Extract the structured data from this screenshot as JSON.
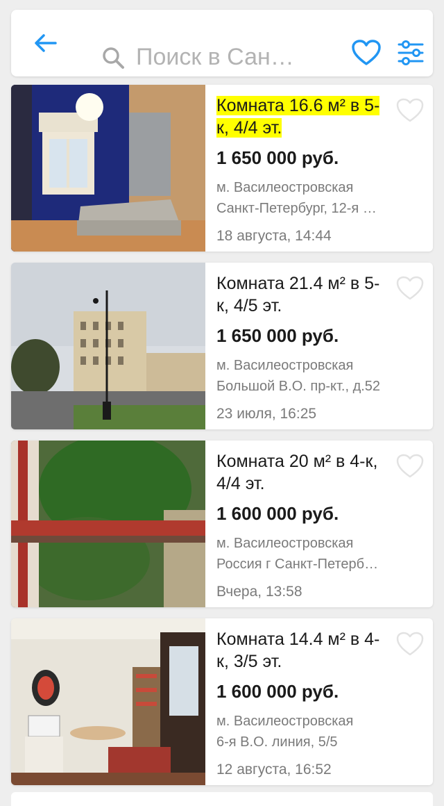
{
  "search": {
    "placeholder": "Поиск в Сан…"
  },
  "colors": {
    "accent": "#2196f3",
    "highlight": "#ffff00"
  },
  "listings": [
    {
      "title": "Комната 16.6 м² в 5-к, 4/4 эт.",
      "highlighted": true,
      "price": "1 650 000 руб.",
      "metro": "м. Василеостровская",
      "address": "Санкт-Петербург, 12-я …",
      "date": "18 августа, 14:44",
      "photo": "room-with-lamp-and-sofa"
    },
    {
      "title": "Комната 21.4 м² в 5-к, 4/5 эт.",
      "highlighted": false,
      "price": "1 650 000 руб.",
      "metro": "м. Василеостровская",
      "address": "Большой В.О. пр-кт., д.52",
      "date": "23 июля, 16:25",
      "photo": "building-street-view"
    },
    {
      "title": "Комната 20 м² в 4-к, 4/4 эт.",
      "highlighted": false,
      "price": "1 600 000 руб.",
      "metro": "м. Василеостровская",
      "address": "Россия г Санкт-Петерб…",
      "date": "Вчера, 13:58",
      "photo": "window-with-trees"
    },
    {
      "title": "Комната 14.4 м² в 4-к, 3/5 эт.",
      "highlighted": false,
      "price": "1 600 000 руб.",
      "metro": "м. Василеостровская",
      "address": "6-я В.О. линия, 5/5",
      "date": "12 августа, 16:52",
      "photo": "room-interior-with-shelves"
    }
  ]
}
